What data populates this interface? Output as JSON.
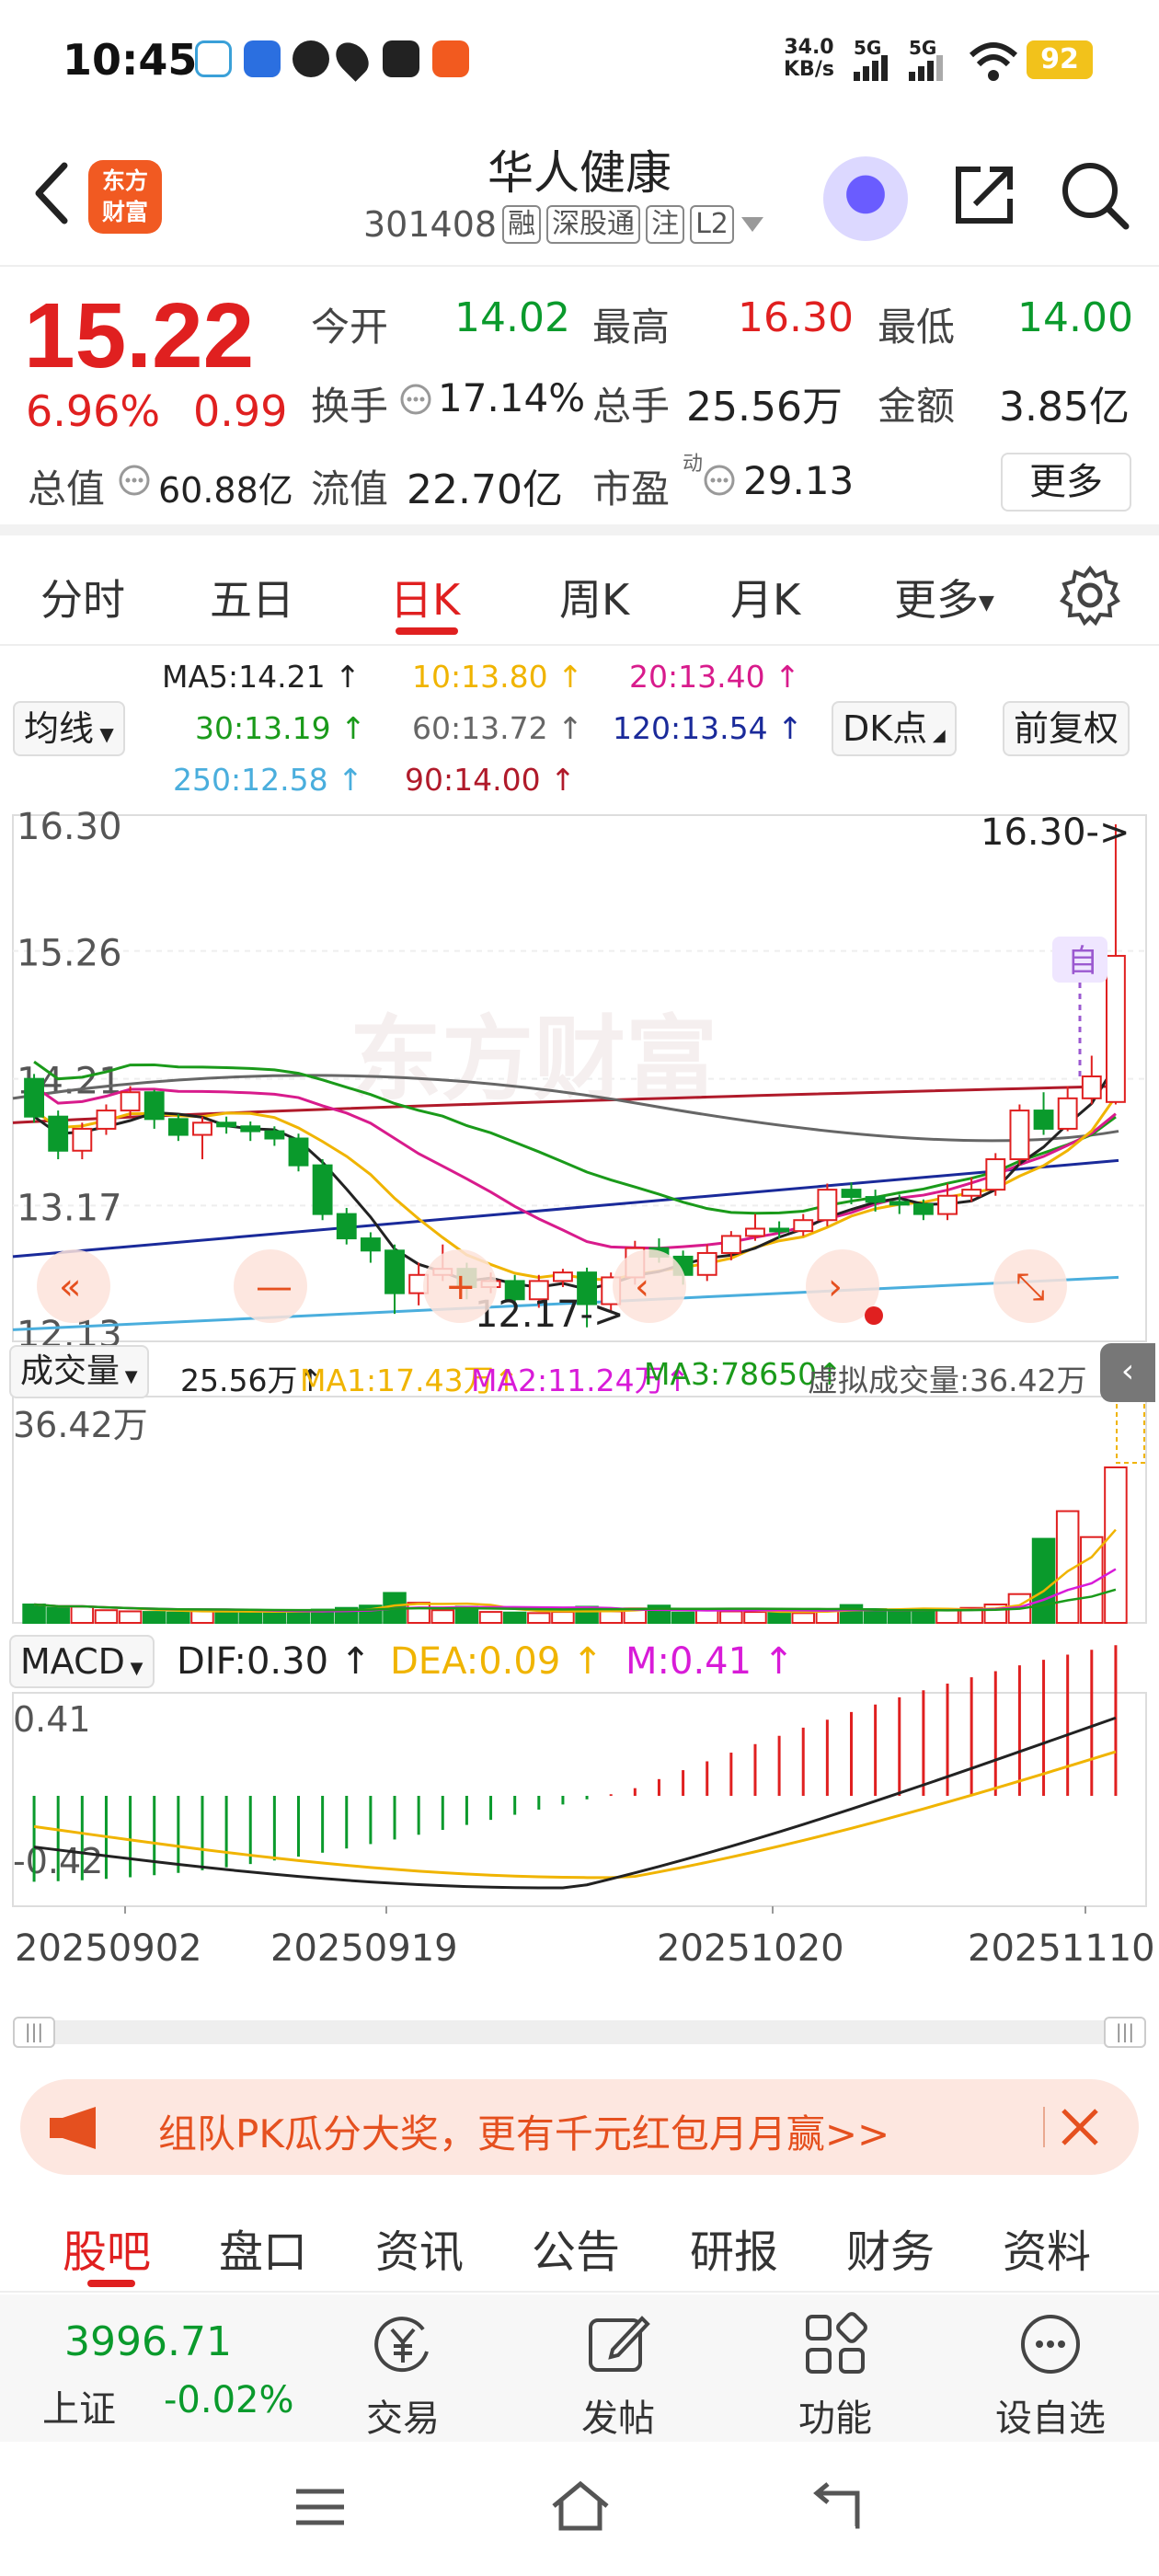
{
  "status_bar": {
    "time": "10:45",
    "net_speed_top": "34.0",
    "net_speed_bottom": "KB/s",
    "signal1": "5G",
    "signal2": "5G",
    "battery": "92"
  },
  "header": {
    "logo_line1": "东方",
    "logo_line2": "财富",
    "stock_name": "华人健康",
    "stock_code": "301408",
    "tags": [
      "融",
      "深股通",
      "注",
      "L2"
    ]
  },
  "quote": {
    "price": "15.22",
    "pct": "6.96%",
    "change": "0.99",
    "open_label": "今开",
    "open": "14.02",
    "high_label": "最高",
    "high": "16.30",
    "low_label": "最低",
    "low": "14.00",
    "turnover_label": "换手",
    "turnover": "17.14%",
    "volume_label": "总手",
    "volume": "25.56万",
    "amount_label": "金额",
    "amount": "3.85亿",
    "mcap_label": "总值",
    "mcap": "60.88亿",
    "float_label": "流值",
    "float": "22.70亿",
    "pe_label": "市盈",
    "pe_sup": "动",
    "pe": "29.13",
    "more_label": "更多"
  },
  "chart_tabs": {
    "tabs": [
      "分时",
      "五日",
      "日K",
      "周K",
      "月K",
      "更多"
    ],
    "active": "日K"
  },
  "ma_bar": {
    "ma_select": "均线",
    "ma5": "MA5:14.21",
    "ma10": "10:13.80",
    "ma20": "20:13.40",
    "ma30": "30:13.19",
    "ma60": "60:13.72",
    "ma120": "120:13.54",
    "ma250": "250:12.58",
    "ma90": "90:14.00",
    "dk_label": "DK点",
    "adjust_label": "前复权"
  },
  "colors": {
    "up": "#e02020",
    "down": "#0a9a2c",
    "ma5": "#222222",
    "ma10": "#f0b400",
    "ma20": "#d81b8c",
    "ma30": "#1a9a1a",
    "ma60": "#666666",
    "ma120": "#1a2a9a",
    "ma250": "#4aaedd",
    "ma90": "#b01a2a"
  },
  "kline": {
    "y_labels": [
      "16.30",
      "15.26",
      "14.21",
      "13.17",
      "12.13"
    ],
    "high_marker": "16.30->",
    "low_marker": "12.17->",
    "self_tag": "自",
    "watermark": "东方财富",
    "candles": [
      [
        14.21,
        13.9,
        14.25,
        13.85
      ],
      [
        13.9,
        13.62,
        13.95,
        13.55
      ],
      [
        13.62,
        13.8,
        13.85,
        13.55
      ],
      [
        13.8,
        13.95,
        14.0,
        13.75
      ],
      [
        13.95,
        14.1,
        14.15,
        13.9
      ],
      [
        14.1,
        13.88,
        14.12,
        13.8
      ],
      [
        13.88,
        13.75,
        13.92,
        13.7
      ],
      [
        13.75,
        13.85,
        13.9,
        13.55
      ],
      [
        13.85,
        13.82,
        13.9,
        13.76
      ],
      [
        13.82,
        13.78,
        13.86,
        13.7
      ],
      [
        13.78,
        13.72,
        13.82,
        13.66
      ],
      [
        13.72,
        13.5,
        13.76,
        13.45
      ],
      [
        13.5,
        13.1,
        13.55,
        13.05
      ],
      [
        13.1,
        12.9,
        13.15,
        12.85
      ],
      [
        12.9,
        12.8,
        12.95,
        12.7
      ],
      [
        12.8,
        12.45,
        12.85,
        12.28
      ],
      [
        12.45,
        12.6,
        12.7,
        12.35
      ],
      [
        12.6,
        12.65,
        12.85,
        12.55
      ],
      [
        12.65,
        12.5,
        12.7,
        12.4
      ],
      [
        12.5,
        12.55,
        12.62,
        12.45
      ],
      [
        12.55,
        12.4,
        12.6,
        12.35
      ],
      [
        12.4,
        12.55,
        12.6,
        12.33
      ],
      [
        12.55,
        12.62,
        12.65,
        12.5
      ],
      [
        12.62,
        12.36,
        12.66,
        12.17
      ],
      [
        12.36,
        12.58,
        12.62,
        12.3
      ],
      [
        12.58,
        12.82,
        12.88,
        12.52
      ],
      [
        12.82,
        12.75,
        12.9,
        12.7
      ],
      [
        12.75,
        12.6,
        12.8,
        12.52
      ],
      [
        12.6,
        12.78,
        12.85,
        12.55
      ],
      [
        12.78,
        12.92,
        12.96,
        12.72
      ],
      [
        12.92,
        12.98,
        13.1,
        12.88
      ],
      [
        12.98,
        12.96,
        13.04,
        12.9
      ],
      [
        12.96,
        13.05,
        13.1,
        12.92
      ],
      [
        13.05,
        13.3,
        13.35,
        13.0
      ],
      [
        13.3,
        13.24,
        13.36,
        13.18
      ],
      [
        13.24,
        13.2,
        13.3,
        13.12
      ],
      [
        13.2,
        13.18,
        13.26,
        13.1
      ],
      [
        13.18,
        13.1,
        13.22,
        13.05
      ],
      [
        13.1,
        13.25,
        13.35,
        13.05
      ],
      [
        13.25,
        13.3,
        13.4,
        13.2
      ],
      [
        13.3,
        13.55,
        13.6,
        13.25
      ],
      [
        13.55,
        13.95,
        14.0,
        13.5
      ],
      [
        13.95,
        13.8,
        14.1,
        13.75
      ],
      [
        13.8,
        14.05,
        14.15,
        13.78
      ],
      [
        14.05,
        14.23,
        14.4,
        14.0
      ],
      [
        14.02,
        15.22,
        16.3,
        14.0
      ]
    ]
  },
  "volume": {
    "select": "成交量",
    "vol": "25.56万",
    "ma1": "MA1:17.43万",
    "ma2": "MA2:11.24万",
    "ma3": "MA3:78650",
    "virtual": "虚拟成交量:36.42万",
    "y_label": "36.42万",
    "bars": [
      3.2,
      2.6,
      2.8,
      2.2,
      2.0,
      1.9,
      1.8,
      2.2,
      2.1,
      1.9,
      1.8,
      2.0,
      2.3,
      2.6,
      3.0,
      5.2,
      3.5,
      2.2,
      2.8,
      1.9,
      1.8,
      1.7,
      1.9,
      2.8,
      2.0,
      2.5,
      3.0,
      1.8,
      2.2,
      2.0,
      1.9,
      1.8,
      1.7,
      2.4,
      3.1,
      2.4,
      2.2,
      2.3,
      2.2,
      2.6,
      3.2,
      5.0,
      14.6,
      19.4,
      14.9,
      27.0
    ]
  },
  "macd": {
    "select": "MACD",
    "dif": "DIF:0.30",
    "dea": "DEA:0.09",
    "m": "M:0.41",
    "y_top": "0.41",
    "y_bottom": "-0.42"
  },
  "dates": [
    "20250902",
    "20250919",
    "20251020",
    "20251110"
  ],
  "promo": {
    "text": "组队PK瓜分大奖，更有千元红包月月赢>>"
  },
  "bottom_tabs": {
    "tabs": [
      "股吧",
      "盘口",
      "资讯",
      "公告",
      "研报",
      "财务",
      "资料"
    ],
    "active": "股吧"
  },
  "footer": {
    "index_value": "3996.71",
    "index_name": "上证",
    "index_change": "-0.02%",
    "trade": "交易",
    "post": "发帖",
    "func": "功能",
    "watch": "设自选"
  }
}
